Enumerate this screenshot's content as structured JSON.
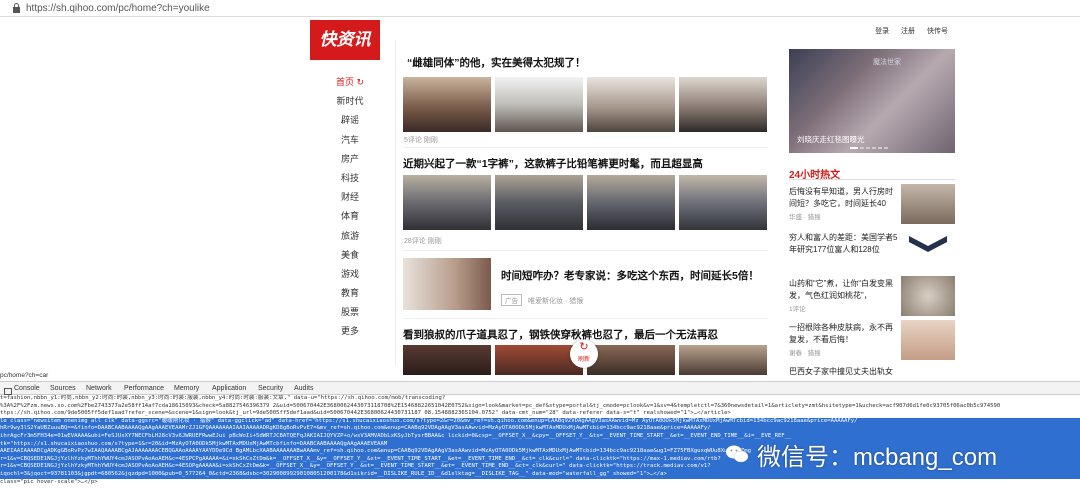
{
  "browser": {
    "url": "https://sh.qihoo.com/pc/home?ch=youlike"
  },
  "top_links": [
    "登录",
    "注册",
    "快传号"
  ],
  "logo": "快资讯",
  "nav": [
    "首页",
    "新时代",
    "辟谣",
    "汽车",
    "房产",
    "科技",
    "财经",
    "体育",
    "旅游",
    "美食",
    "游戏",
    "教育",
    "股票",
    "更多"
  ],
  "articles": [
    {
      "title": "“雌雄同体”的他，实在美得太犯规了！",
      "meta": "5评论   刚刚"
    },
    {
      "title": "近期兴起了一款“1字裤”，这款裤子比铅笔裤更时髦，而且超显高",
      "meta": "28评论   刚刚"
    },
    {
      "title": "时间短咋办？老专家说：多吃这个东西，时间延长5倍！",
      "ad_label": "广告",
      "meta": "唯爱斯化妆 · 猎猴"
    },
    {
      "title": "看到狼叔的爪子道具忍了，钢铁侠穿秋裤也忍了，最后一个无法再忍",
      "refresh_label": "刷新"
    }
  ],
  "banner": {
    "caption": "刘晓庆走红毯图曝光",
    "tag": "魔法世家"
  },
  "hot": {
    "title": "24小时热文",
    "items": [
      {
        "text": "后悔没有早知道，男人行房时间短？多吃它，时间延长40",
        "meta": "华盛 · 猎猴"
      },
      {
        "text": "穷人和富人的差距：美国学者5年研究177位富人和128位",
        "meta": ""
      },
      {
        "text": "山药和“它”煮，让你“白发变黑发，气色红润如桃花”，",
        "meta": "1评论"
      },
      {
        "text": "一招根除各种皮肤病，永不再复发，不看后悔！",
        "meta": "谢春 · 猎猴"
      },
      {
        "text": "巴西女子家中撞见丈夫出轨女",
        "meta": ""
      }
    ]
  },
  "status_url": "pc/home?ch=car",
  "devtools_tabs": [
    "Console",
    "Sources",
    "Network",
    "Performance",
    "Memory",
    "Application",
    "Security",
    "Audits"
  ],
  "code_lines": [
    "t=fashion,nbbn_y1:时尚,nbbn_y2:时尚:时装,nbbn_y3:时尚:时装:服装,nbbn_y4:时尚:时装:服装:文章,\" data-u=\"https://sh.qihoo.com/mob/transcoding?",
    "%3A%2F%2Fzm.news.so.com%2Fbe2743377a2e58ff14af7cda18615093&check=5a8827546396379 2&uid=500670442E3680062443073118708%2E15468822651042E0752&sign=look&market=pc_def&stype=portal&tj_cmode=pclook&v=1&sv=4&templetctl=7&360newsdetail=1&articlety=zmt&hsitetype=1&ucheck=acf907d6d1fe0c93705f06ac0b5c974590",
    "ttps://sh.qihoo.com/9de5005ff5def1aad?refer_scene=&scene=1&sign=look&tj_url=9de5005ff5def1aad&uid=500670442E36800624430731187 08.1548882365104.0752\" data-cmt_num=\"28\" data-referer data-s=\"t\" realshowed=\"1\">…</article>",
    "le class=\"newsitem onenimg all clk\" data-ggsrc=\"暖暖刚化妆 · 猎猴\" data-ggclick=\"ad\" data-href=\"https://s1.shucaixiaoshuo.com/s?type=2&r=20&mv_ref=sh.qihoo.com&enup=CAABq92VDAgAAgV3asAAwvid=Mz AyOTA0ODk5MjkwMTAxMDUxMjAwMTcbid=134bcc9ac9218aae&price=AAAAAFy/",
    "hRr9wy3lS2YaUBZuuuBQ==&finfo=DAABCAABAAAAQgAAgAAAEVEAAMrZJ1GFQAAAAAAAIAAIAAAAADRgKD8gBoRvPvE7=&mv_ref=sh.qihoo.com&enup=CAABq92VDAgAAgV3asAAwvid=MzAyOTA0ODk5MjkwMTAxMDUxMjAwMTcbid=134bcc9ac9218aae&price=AAAAAFy/",
    "ihrAgcFr3m5FH34e=01wEVAAAA&ubi=FeSJUxXY7NECFbLH28cV3v6JWRUEFRwwEJui pBcWoIi+5dWRTJCBATQEFqJAKIAIJQYVZP+o/wsV3AMVADbLxKSyJbTysrBBAA&c lickid=0&csp=__OFFSET_X__&cpy=__OFFSET_Y__&ts=__EVENT_TIME_START__&et=__EVENT_END_TIME__&i=__EVE_REF__",
    "tk=\"https://s1.shucaixiaoshuo.com/s?type=1&r=20&id=MzAyOTA0ODk5MjkwMTAxMDUxMjAwMTcbfinfo=DAABCAABAAAAQgAAgAAAEVEAAM",
    "AAEIAAIAAAADCgADKgGBoRvPz7wIAAQAAAABCgAJAAAAAAACEBQGAAoAAAAYAAYDDe9Cd BgAMLbcXAABAAAAAAABwAAAmv_ref=sh.qihoo.com&enup=CAABq92VDAgAAgV3asAAwvid=MzAyOTA0ODk5MjkwMTAxMDUxMjAwMTcbid=134bcc9ac9218aae&ug1=FZ75FBXguxqWUu8Xu6NcFZmg",
    "r=1&v=CBQSEDE1NGJjYzlhYzkyMThhYWUY4cmJASOPvAoAoAEH&c=4ESPCPgAAAAA=&i=xkShCxZtDm&k=__OFFSET_X__&y=__OFFSET_Y__&st=__EVENT_TIME_START__&et=__EVENT_TIME_END__&ct=_clk&curl=\" data-clicktk=\"https://max-1.mediav.com/rtb?",
    "r=1&v=CBQSEDE1NGJjYzlhYzkyMThhYWUY4cmJASOPvAoAoAEH&c=4ESOPgAAAAA&i=xkShCxZtDm&k=__OFFSET_X__&y=__OFFSET_Y__&st=__EVENT_TIME_START__&et=__EVENT_TIME_END__&ct=_clk&curl=\" data-clicktk=\"https://track.mediav.com/v1?",
    "iqochl=3&jqoct=93781103&jgpdt=680562&jqzdpd=1000&pub=0_577264_0&ctd=2368&dsbc=302900899290108051200178&d1sikrid=__DISLIKE_RULE_ID__&d1slktag=__DISLIKE_TAG__\" data-mod=\"waterfall_gg\" showed=\"1\">…</a>",
    "class=\"pic hover-scale\">…</p>"
  ],
  "watermark": "微信号：mcbang_com",
  "colors": {
    "brand_red": "#d41a1a",
    "devtools_highlight": "#2f6fd0"
  }
}
